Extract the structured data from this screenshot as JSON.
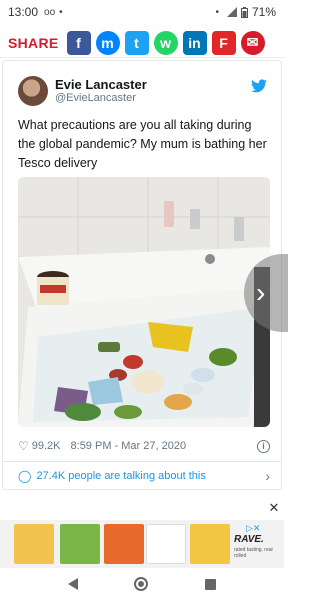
{
  "status_bar": {
    "time": "13:00",
    "battery": "71%"
  },
  "share_bar": {
    "label": "SHARE",
    "buttons": [
      {
        "name": "facebook-share-button",
        "icon": "facebook-icon",
        "color": "#3b5998",
        "glyph": "f"
      },
      {
        "name": "messenger-share-button",
        "icon": "messenger-icon",
        "color": "#0084ff",
        "glyph": "m"
      },
      {
        "name": "twitter-share-button",
        "icon": "twitter-icon",
        "color": "#1da1f2",
        "glyph": "t"
      },
      {
        "name": "whatsapp-share-button",
        "icon": "whatsapp-icon",
        "color": "#25d366",
        "glyph": "w"
      },
      {
        "name": "linkedin-share-button",
        "icon": "linkedin-icon",
        "color": "#0077b5",
        "glyph": "in"
      },
      {
        "name": "flipboard-share-button",
        "icon": "flipboard-icon",
        "color": "#e12828",
        "glyph": "F"
      },
      {
        "name": "email-share-button",
        "icon": "email-icon",
        "color": "#d81b2c",
        "glyph": "✉"
      }
    ]
  },
  "tweet": {
    "author_name": "Evie Lancaster",
    "author_handle": "@EvieLancaster",
    "text": "What precautions are you all taking during the global pandemic? My mum is bathing her Tesco delivery",
    "likes": "99.2K",
    "timestamp": "8:59 PM - Mar 27, 2020",
    "talking": "27.4K people are talking about this",
    "brand_color": "#1da1f2",
    "link_color": "#1b95e0"
  },
  "ad": {
    "brand": "RAVE.",
    "tagline": "rated tasting. real rolled"
  }
}
